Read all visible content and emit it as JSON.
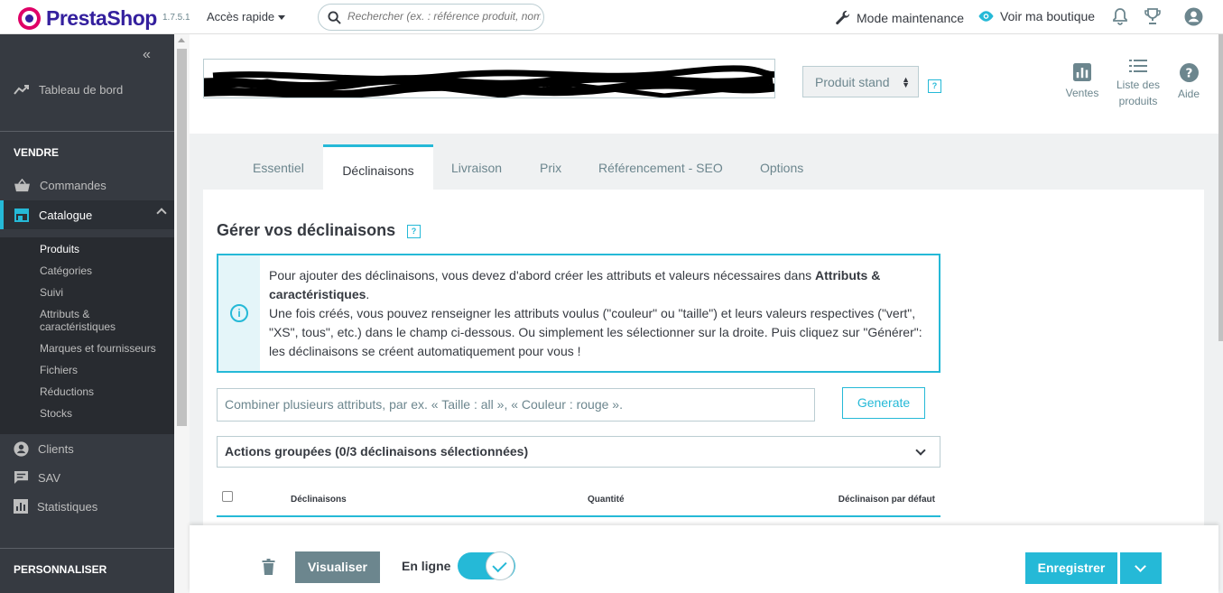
{
  "header": {
    "brand": "PrestaShop",
    "version": "1.7.5.1",
    "quick_access": "Accès rapide",
    "search_placeholder": "Rechercher (ex. : référence produit, nom",
    "maintenance": "Mode maintenance",
    "view_shop": "Voir ma boutique"
  },
  "sidebar": {
    "dashboard": "Tableau de bord",
    "section_sell": "VENDRE",
    "orders": "Commandes",
    "catalog": "Catalogue",
    "catalog_items": [
      "Produits",
      "Catégories",
      "Suivi",
      "Attributs &",
      "caractéristiques",
      "Marques et fournisseurs",
      "Fichiers",
      "Réductions",
      "Stocks"
    ],
    "customers": "Clients",
    "service": "SAV",
    "stats": "Statistiques",
    "section_customize": "PERSONNALISER"
  },
  "page_head": {
    "product_type": "Produit stand",
    "help": "?",
    "tools": {
      "sales": "Ventes",
      "product_list_1": "Liste des",
      "product_list_2": "produits",
      "help": "Aide"
    }
  },
  "tabs": [
    "Essentiel",
    "Déclinaisons",
    "Livraison",
    "Prix",
    "Référencement - SEO",
    "Options"
  ],
  "combinations": {
    "title": "Gérer vos déclinaisons",
    "alert_line1_a": "Pour ajouter des déclinaisons, vous devez d'abord créer les attributs et valeurs nécessaires dans ",
    "alert_line1_b": "Attributs &",
    "alert_line2_b": "caractéristiques",
    "alert_line2_c": ".",
    "alert_rest": "Une fois créés, vous pouvez renseigner les attributs voulus (\"couleur\" ou \"taille\") et leurs valeurs respectives (\"vert\", \"XS\", tous\", etc.) dans le champ ci-dessous. Ou simplement les sélectionner sur la droite. Puis cliquez sur \"Générer\": les déclinaisons se créent automatiquement pour vous !",
    "combine_placeholder": "Combiner plusieurs attributs, par ex. « Taille : all », « Couleur : rouge ».",
    "generate": "Generate",
    "bulk_actions": "Actions groupées (0/3 déclinaisons sélectionnées)",
    "table_headers": [
      "Déclinaisons",
      "Quantité",
      "Déclinaison par défaut"
    ]
  },
  "footer": {
    "preview": "Visualiser",
    "online": "En ligne",
    "online_enabled": true,
    "save": "Enregistrer"
  },
  "colors": {
    "accent": "#25b9d7",
    "brand": "#34209e",
    "sidebar_bg": "#363a41"
  }
}
